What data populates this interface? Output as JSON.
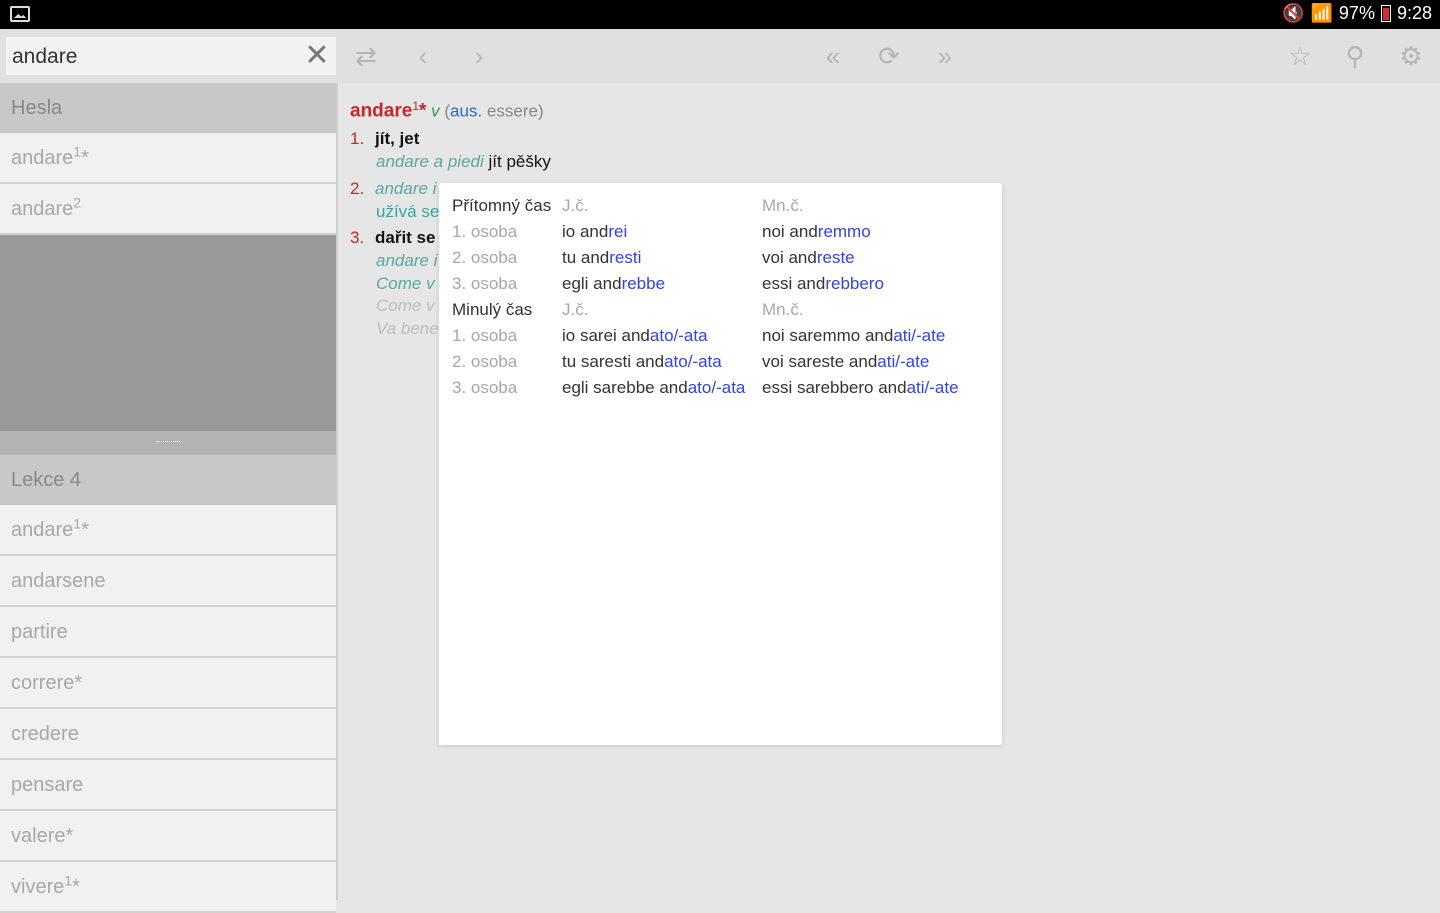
{
  "status_bar": {
    "battery": "97%",
    "time": "9:28"
  },
  "toolbar": {
    "search_value": "andare",
    "icons": [
      "swap-icon",
      "back-icon",
      "forward-icon",
      "first-icon",
      "refresh-icon",
      "last-icon",
      "star-icon",
      "search-icon",
      "gear-icon"
    ]
  },
  "sidebar": {
    "section1_title": "Hesla",
    "section1_items": [
      {
        "text": "andare",
        "sup": "1",
        "mark": "*"
      },
      {
        "text": "andare",
        "sup": "2",
        "mark": ""
      }
    ],
    "section2_title": "Lekce 4",
    "section2_items": [
      {
        "text": "andare",
        "sup": "1",
        "mark": "*"
      },
      {
        "text": "andarsene",
        "sup": "",
        "mark": ""
      },
      {
        "text": "partire",
        "sup": "",
        "mark": ""
      },
      {
        "text": "correre",
        "sup": "",
        "mark": "*"
      },
      {
        "text": "credere",
        "sup": "",
        "mark": ""
      },
      {
        "text": "pensare",
        "sup": "",
        "mark": ""
      },
      {
        "text": "valere",
        "sup": "",
        "mark": "*"
      },
      {
        "text": "vivere",
        "sup": "1",
        "mark": "*"
      }
    ]
  },
  "entry": {
    "headword": "andare",
    "superscript": "1",
    "mark": "*",
    "pos": "v",
    "grammar_open": "(",
    "grammar_aus": "aus.",
    "grammar_rest": "essere)",
    "senses": [
      {
        "num": "1.",
        "translation": "jít, jet",
        "examples": [
          {
            "it": "andare a piedi",
            "cz": "jít pěšky"
          }
        ]
      },
      {
        "num": "2.",
        "text": "andare i",
        "note": "užívá se"
      },
      {
        "num": "3.",
        "translation": "dařit se",
        "examples": [
          {
            "it": "andare i"
          },
          {
            "it": "Come v"
          },
          {
            "it": "Come v"
          },
          {
            "it": "Va bene"
          }
        ]
      }
    ]
  },
  "conjugation": {
    "present": {
      "title": "Přítomný čas",
      "sg": "J.č.",
      "pl": "Mn.č.",
      "rows": [
        {
          "person": "1. osoba",
          "sg_stem": "io and",
          "sg_end": "rei",
          "pl_stem": "noi and",
          "pl_end": "remmo"
        },
        {
          "person": "2. osoba",
          "sg_stem": "tu and",
          "sg_end": "resti",
          "pl_stem": "voi and",
          "pl_end": "reste"
        },
        {
          "person": "3. osoba",
          "sg_stem": "egli and",
          "sg_end": "rebbe",
          "pl_stem": "essi and",
          "pl_end": "rebbero"
        }
      ]
    },
    "past": {
      "title": "Minulý čas",
      "sg": "J.č.",
      "pl": "Mn.č.",
      "rows": [
        {
          "person": "1. osoba",
          "sg_stem": "io sarei and",
          "sg_end": "ato/-ata",
          "pl_stem": "noi saremmo and",
          "pl_end": "ati/-ate"
        },
        {
          "person": "2. osoba",
          "sg_stem": "tu saresti and",
          "sg_end": "ato/-ata",
          "pl_stem": "voi sareste and",
          "pl_end": "ati/-ate"
        },
        {
          "person": "3. osoba",
          "sg_stem": "egli sarebbe and",
          "sg_end": "ato/-ata",
          "pl_stem": "essi sarebbero and",
          "pl_end": "ati/-ate"
        }
      ]
    }
  }
}
